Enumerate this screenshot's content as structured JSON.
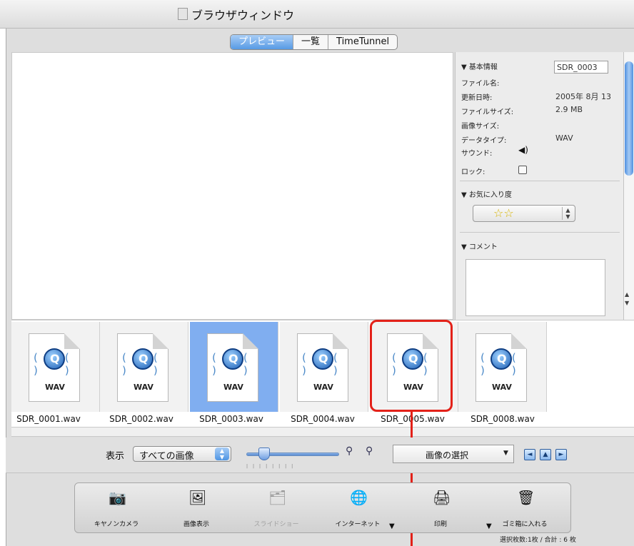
{
  "window": {
    "title": "ブラウザウィンドウ"
  },
  "tabs": [
    {
      "label": "プレビュー",
      "active": true
    },
    {
      "label": "一覧",
      "active": false
    },
    {
      "label": "TimeTunnel",
      "active": false
    }
  ],
  "info_panel": {
    "basic_header": "▼ 基本情報",
    "labels": {
      "filename": "ファイル名:",
      "modified": "更新日時:",
      "filesize": "ファイルサイズ:",
      "image_size": "画像サイズ:",
      "datatype": "データタイプ:",
      "sound": "サウンド:",
      "lock": "ロック:"
    },
    "values": {
      "filename": "SDR_0003",
      "modified": "2005年 8月 13",
      "filesize": "2.9 MB",
      "datatype": "WAV"
    },
    "lock_checked": false,
    "favorite_header": "▼ お気に入り度",
    "favorite_stars": "☆☆",
    "favorite_rating": 2,
    "comment_header": "▼ コメント",
    "comment_text": ""
  },
  "thumbnails": [
    {
      "filename": "SDR_0001.wav",
      "type_label": "WAV",
      "selected": false
    },
    {
      "filename": "SDR_0002.wav",
      "type_label": "WAV",
      "selected": false
    },
    {
      "filename": "SDR_0003.wav",
      "type_label": "WAV",
      "selected": true
    },
    {
      "filename": "SDR_0004.wav",
      "type_label": "WAV",
      "selected": false
    },
    {
      "filename": "SDR_0005.wav",
      "type_label": "WAV",
      "selected": false
    },
    {
      "filename": "SDR_0008.wav",
      "type_label": "WAV",
      "selected": false
    }
  ],
  "highlight": {
    "target": "SDR_0005.wav",
    "color": "#e32119"
  },
  "controls": {
    "display_label": "表示",
    "display_value": "すべての画像",
    "image_select_value": "画像の選択",
    "thumbnail_size_level": 0.18
  },
  "toolbar": [
    {
      "label": "キヤノンカメラ",
      "icon": "camera-icon",
      "enabled": true
    },
    {
      "label": "画像表示",
      "icon": "image-view-icon",
      "enabled": true
    },
    {
      "label": "スライドショー",
      "icon": "slideshow-icon",
      "enabled": false
    },
    {
      "label": "インターネット",
      "icon": "internet-icon",
      "enabled": true
    },
    {
      "label": "印刷",
      "icon": "print-icon",
      "enabled": true
    },
    {
      "label": "ゴミ箱に入れる",
      "icon": "trash-icon",
      "enabled": true
    }
  ],
  "status": {
    "text": "選択枚数:1枚 / 合計 : 6 枚"
  },
  "colors": {
    "accent": "#4f95e3",
    "selection": "#80aef0"
  }
}
